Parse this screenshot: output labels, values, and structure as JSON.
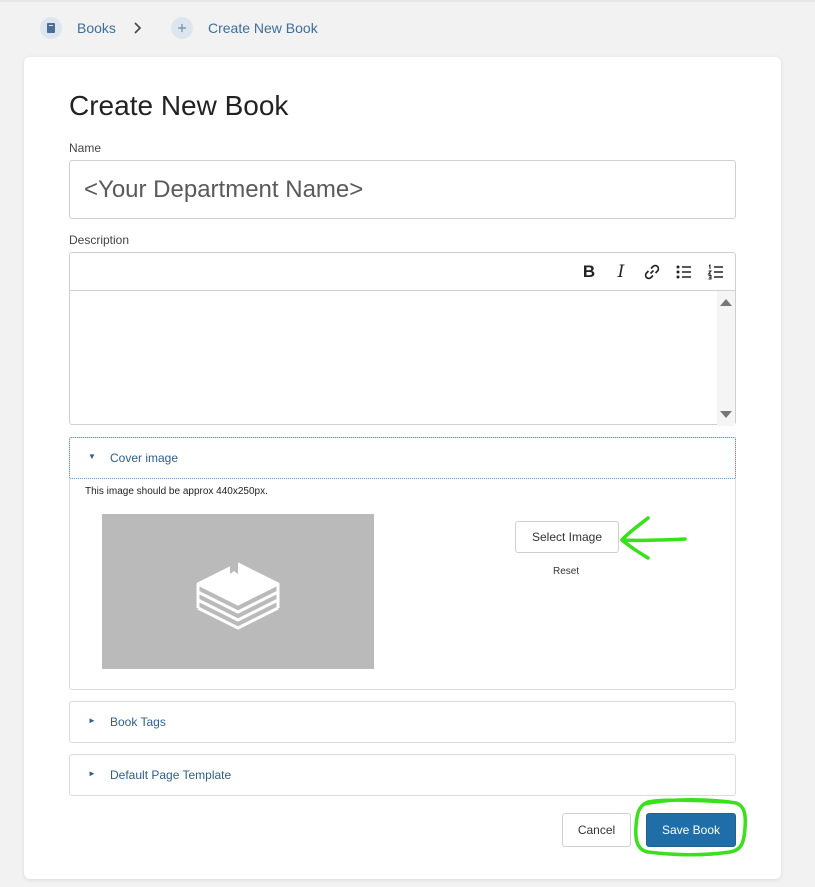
{
  "breadcrumb": {
    "items": [
      {
        "label": "Books",
        "icon": "book-icon"
      },
      {
        "label": "Create New Book",
        "icon": "plus-icon"
      }
    ]
  },
  "page": {
    "title": "Create New Book"
  },
  "form": {
    "name_label": "Name",
    "name_placeholder": "<Your Department Name>",
    "description_label": "Description",
    "editor_toolbar": [
      "bold-icon",
      "italic-icon",
      "link-icon",
      "bullet-list-icon",
      "numbered-list-icon"
    ],
    "editor_labels": {
      "bold": "B",
      "italic": "I"
    }
  },
  "cover_image": {
    "heading": "Cover image",
    "expanded": true,
    "hint": "This image should be approx 440x250px.",
    "select_label": "Select Image",
    "reset_label": "Reset"
  },
  "sections": [
    {
      "heading": "Book Tags",
      "expanded": false
    },
    {
      "heading": "Default Page Template",
      "expanded": false
    }
  ],
  "actions": {
    "cancel_label": "Cancel",
    "save_label": "Save Book"
  },
  "colors": {
    "accent": "#206ea7",
    "link": "#2d5f8b",
    "annotation": "#39e01b"
  }
}
